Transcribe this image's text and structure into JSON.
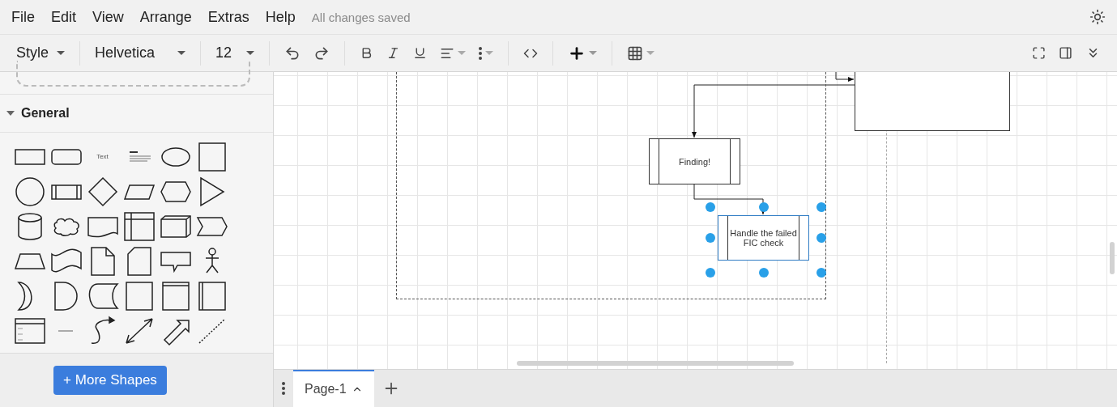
{
  "menu": {
    "items": [
      "File",
      "Edit",
      "View",
      "Arrange",
      "Extras",
      "Help"
    ],
    "status": "All changes saved"
  },
  "toolbar": {
    "style": "Style",
    "font": "Helvetica",
    "size": "12"
  },
  "sidebar": {
    "section": {
      "title": "General",
      "expanded": true
    },
    "shapes": [
      {
        "kind": "rect"
      },
      {
        "kind": "rounded"
      },
      {
        "kind": "text",
        "label": "Text"
      },
      {
        "kind": "heading"
      },
      {
        "kind": "ellipse"
      },
      {
        "kind": "square"
      },
      {
        "kind": "circle"
      },
      {
        "kind": "process"
      },
      {
        "kind": "diamond"
      },
      {
        "kind": "parallelogram"
      },
      {
        "kind": "hexagon"
      },
      {
        "kind": "triangle"
      },
      {
        "kind": "cylinder"
      },
      {
        "kind": "cloud"
      },
      {
        "kind": "document"
      },
      {
        "kind": "internal"
      },
      {
        "kind": "cube"
      },
      {
        "kind": "step"
      },
      {
        "kind": "trapezoid"
      },
      {
        "kind": "tape"
      },
      {
        "kind": "note"
      },
      {
        "kind": "card"
      },
      {
        "kind": "callout"
      },
      {
        "kind": "actor"
      },
      {
        "kind": "or"
      },
      {
        "kind": "delay"
      },
      {
        "kind": "stored"
      },
      {
        "kind": "square"
      },
      {
        "kind": "container"
      },
      {
        "kind": "vcontainer"
      },
      {
        "kind": "list"
      },
      {
        "kind": "listitem"
      },
      {
        "kind": "curve"
      },
      {
        "kind": "biarrow"
      },
      {
        "kind": "arrow"
      },
      {
        "kind": "dashed"
      }
    ],
    "more_shapes": "+ More Shapes"
  },
  "canvas": {
    "nodes": [
      {
        "label": "Finding!",
        "selected": false
      },
      {
        "label": "Handle the failed FIC check",
        "selected": true
      }
    ]
  },
  "pages": [
    {
      "label": "Page-1",
      "selected": true
    }
  ]
}
